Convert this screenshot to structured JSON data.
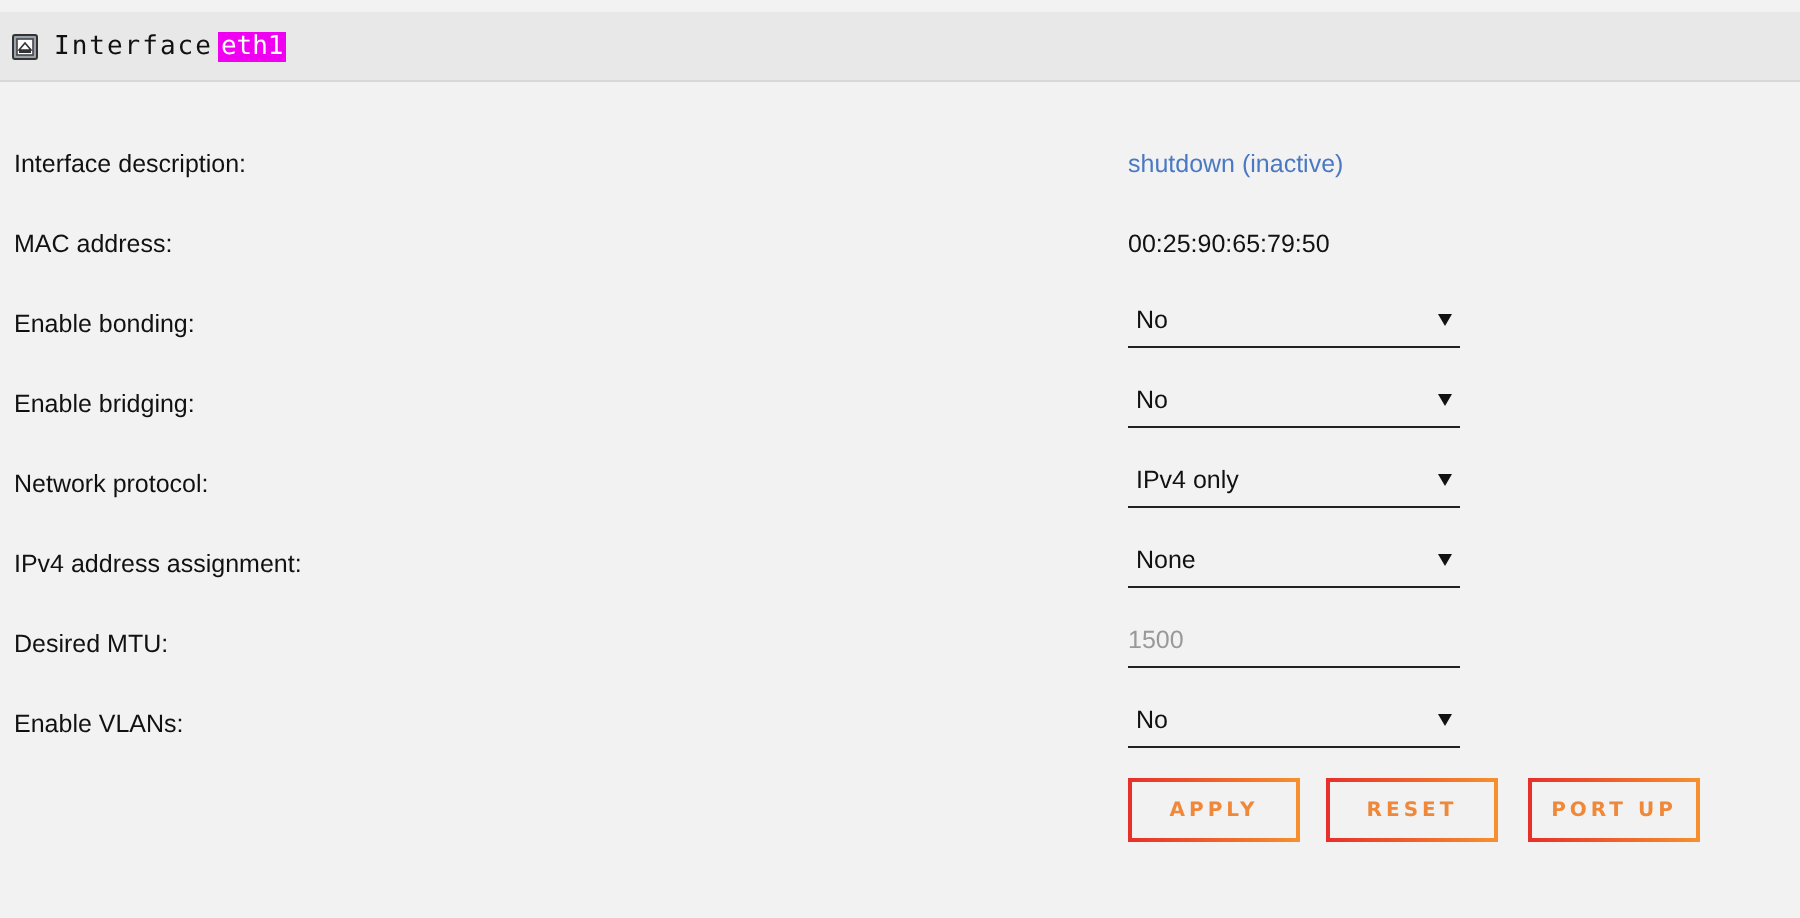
{
  "header": {
    "title": "Interface",
    "name": "eth1"
  },
  "rows": [
    {
      "label": "Interface description:",
      "kind": "link",
      "value": "shutdown (inactive)"
    },
    {
      "label": "MAC address:",
      "kind": "text",
      "value": "00:25:90:65:79:50"
    },
    {
      "label": "Enable bonding:",
      "kind": "select",
      "value": "No"
    },
    {
      "label": "Enable bridging:",
      "kind": "select",
      "value": "No"
    },
    {
      "label": "Network protocol:",
      "kind": "select",
      "value": "IPv4 only"
    },
    {
      "label": "IPv4 address assignment:",
      "kind": "select",
      "value": "None"
    },
    {
      "label": "Desired MTU:",
      "kind": "input",
      "placeholder": "1500"
    },
    {
      "label": "Enable VLANs:",
      "kind": "select",
      "value": "No"
    }
  ],
  "buttons": [
    "APPLY",
    "RESET",
    "PORT UP"
  ]
}
